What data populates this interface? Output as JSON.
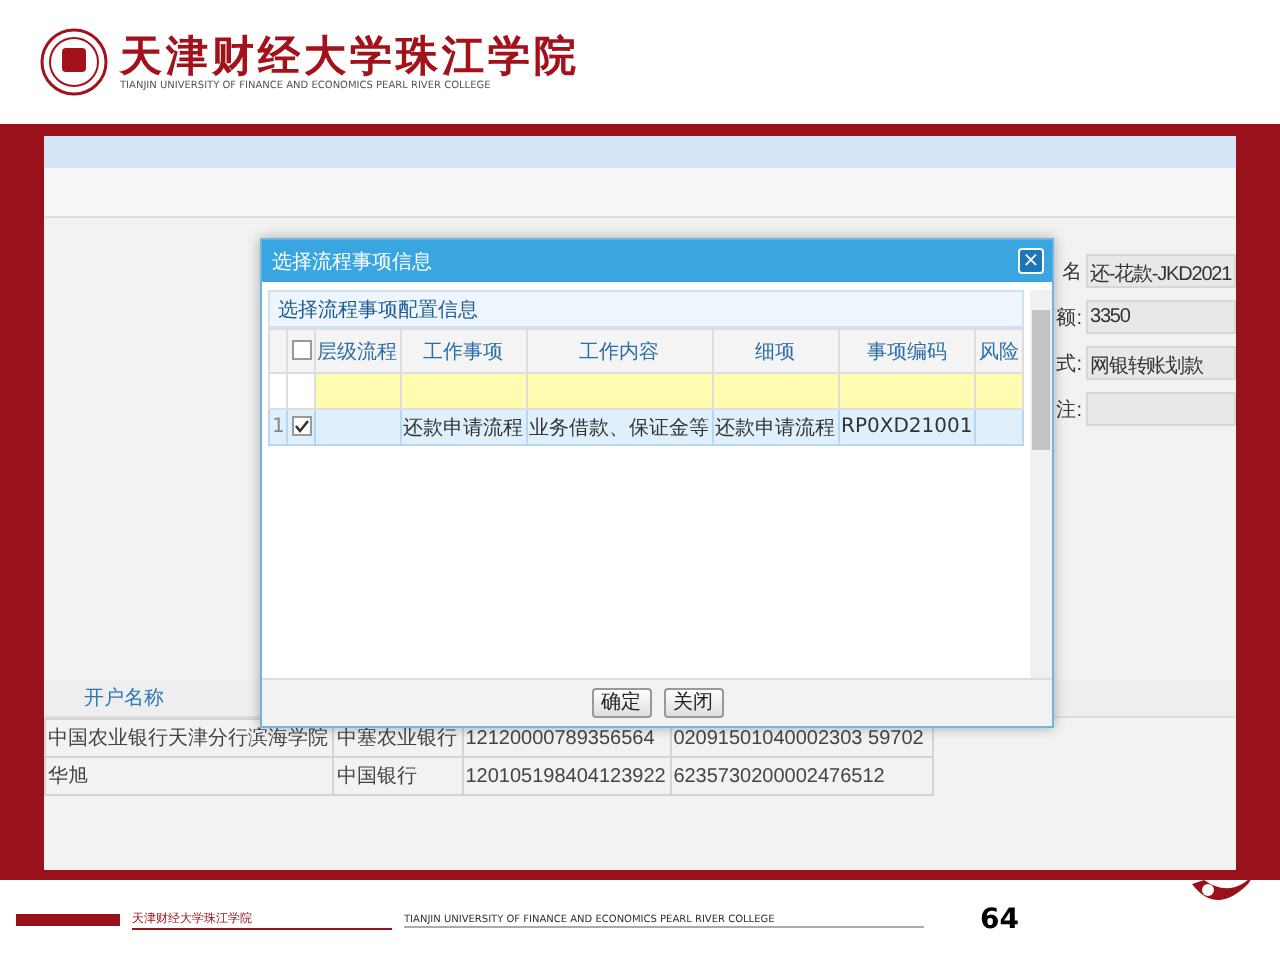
{
  "header": {
    "logo_cn": "天津财经大学珠江学院",
    "logo_en": "TIANJIN UNIVERSITY OF FINANCE AND ECONOMICS PEARL RIVER COLLEGE"
  },
  "form": {
    "fields": [
      {
        "label": "名",
        "value": "还-花款-JKD2021"
      },
      {
        "label": "额:",
        "value": "3350"
      },
      {
        "label": "式:",
        "value": "网银转账划款"
      },
      {
        "label": "注:"
      }
    ]
  },
  "account_table": {
    "columns": [
      "开户名称"
    ],
    "rows": [
      {
        "cells": [
          "中国农业银行天津分行滨海学院",
          "中塞农业银行",
          "12120000789356564",
          "02091501040002303 59702"
        ]
      },
      {
        "cells": [
          "华旭",
          "中国银行",
          "120105198404123922",
          "6235730200002476512"
        ]
      }
    ]
  },
  "dialog": {
    "title": "选择流程事项信息",
    "close": "×",
    "panel_title": "选择流程事项配置信息",
    "columns": [
      "层级流程",
      "工作事项",
      "工作内容",
      "细项",
      "事项编码",
      "风险"
    ],
    "header_checked": false,
    "rows": [
      {
        "number": "1",
        "checked": true,
        "cells": [
          "",
          "还款申请流程",
          "业务借款、保证金等",
          "还款申请流程",
          "RP0XD21001",
          ""
        ]
      }
    ],
    "buttons": [
      "确定",
      "关闭"
    ]
  },
  "footer": {
    "school_cn": "天津财经大学珠江学院",
    "school_en": "TIANJIN UNIVERSITY OF FINANCE AND ECONOMICS PEARL RIVER COLLEGE",
    "page": "64"
  }
}
